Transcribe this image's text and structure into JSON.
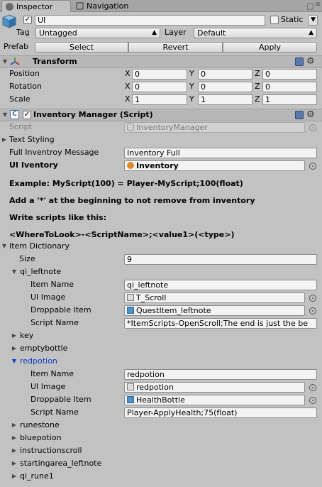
{
  "tabs": [
    {
      "label": "Inspector",
      "active": true
    },
    {
      "label": "Navigation",
      "active": false
    }
  ],
  "gameobject": {
    "name": "UI",
    "active_checked": true,
    "static_label": "Static",
    "tag_label": "Tag",
    "tag_value": "Untagged",
    "layer_label": "Layer",
    "layer_value": "Default",
    "prefab_label": "Prefab",
    "prefab_buttons": [
      "Select",
      "Revert",
      "Apply"
    ]
  },
  "transform": {
    "title": "Transform",
    "rows": [
      {
        "label": "Position",
        "x": "0",
        "y": "0",
        "z": "0"
      },
      {
        "label": "Rotation",
        "x": "0",
        "y": "0",
        "z": "0"
      },
      {
        "label": "Scale",
        "x": "1",
        "y": "1",
        "z": "1"
      }
    ],
    "axis_labels": [
      "X",
      "Y",
      "Z"
    ]
  },
  "component": {
    "title": "Inventory Manager (Script)",
    "script_label": "Script",
    "script_value": "InventoryManager",
    "text_styling_label": "Text Styling",
    "full_msg_label": "Full Inventroy Message",
    "full_msg_value": "Inventory Full",
    "ui_inventory_label": "UI Iventory",
    "ui_inventory_value": "Inventory",
    "info_lines": [
      "Example: MyScript(100) = Player-MyScript;100(float)",
      "Add a '*' at the beginning to not remove from inventory",
      "Write scripts like this:",
      "<WhereToLook>-<ScriptName>;<value1>(<type>)"
    ]
  },
  "dictionary": {
    "label": "Item Dictionary",
    "size_label": "Size",
    "size_value": "9",
    "field_labels": {
      "item_name": "Item Name",
      "ui_image": "UI Image",
      "droppable_item": "Droppable Item",
      "script_name": "Script Name"
    },
    "entries": [
      {
        "label": "qi_leftnote",
        "expanded": true,
        "item_name": "qi_leftnote",
        "ui_image": "T_Scroll",
        "droppable_item": "QuestItem_leftnote",
        "script_name": "*ItemScripts-OpenScroll;The end is just the be"
      },
      {
        "label": "key",
        "expanded": false
      },
      {
        "label": "emptybottle",
        "expanded": false
      },
      {
        "label": "redpotion",
        "expanded": true,
        "selected": true,
        "item_name": "redpotion",
        "ui_image": "redpotion",
        "droppable_item": "HealthBottle",
        "script_name": "Player-ApplyHealth;75(float)"
      },
      {
        "label": "runestone",
        "expanded": false
      },
      {
        "label": "bluepotion",
        "expanded": false
      },
      {
        "label": "instructionscroll",
        "expanded": false
      },
      {
        "label": "startingarea_leftnote",
        "expanded": false
      },
      {
        "label": "qi_rune1",
        "expanded": false
      }
    ]
  },
  "icons": [
    "inspector-icon",
    "navigation-icon",
    "cube-icon",
    "transform-icon",
    "script-icon",
    "book-icon",
    "gear-icon",
    "target-icon",
    "image-icon",
    "prefab-icon"
  ],
  "colors": {
    "panel": "#c2c2c2",
    "selected_text": "#0c3ec3",
    "field": "#f3f3f3"
  }
}
